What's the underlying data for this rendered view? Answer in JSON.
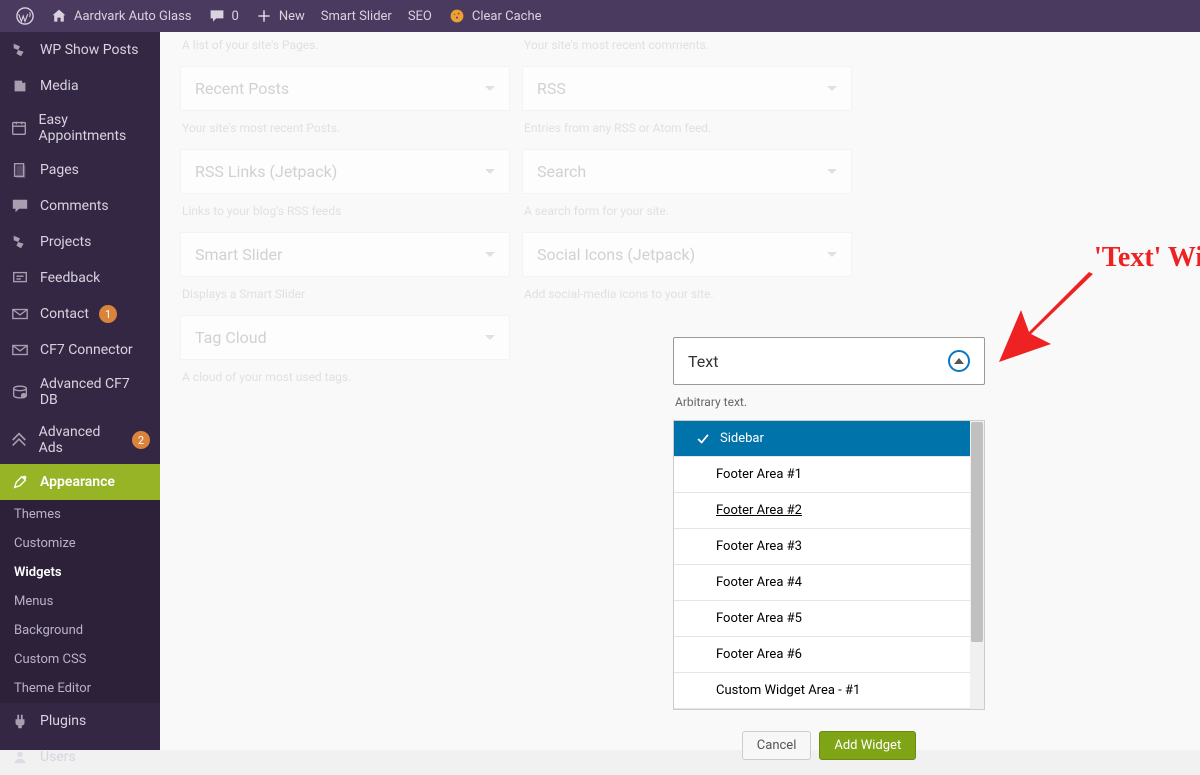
{
  "adminbar": {
    "site_name": "Aardvark Auto Glass",
    "comments": "0",
    "new": "New",
    "smart_slider": "Smart Slider",
    "seo": "SEO",
    "clear_cache": "Clear Cache"
  },
  "sidebar": {
    "items": [
      {
        "label": "WP Show Posts"
      },
      {
        "label": "Media"
      },
      {
        "label": "Easy Appointments"
      },
      {
        "label": "Pages"
      },
      {
        "label": "Comments"
      },
      {
        "label": "Projects"
      },
      {
        "label": "Feedback"
      },
      {
        "label": "Contact",
        "badge": "1"
      },
      {
        "label": "CF7 Connector"
      },
      {
        "label": "Advanced CF7 DB"
      },
      {
        "label": "Advanced Ads",
        "badge": "2"
      },
      {
        "label": "Appearance",
        "active": true
      },
      {
        "label": "Plugins"
      },
      {
        "label": "Users"
      }
    ],
    "submenu": [
      {
        "label": "Themes"
      },
      {
        "label": "Customize"
      },
      {
        "label": "Widgets",
        "current": true
      },
      {
        "label": "Menus"
      },
      {
        "label": "Background"
      },
      {
        "label": "Custom CSS"
      },
      {
        "label": "Theme Editor"
      }
    ]
  },
  "widgets_left": [
    {
      "title": "",
      "desc": "A list of your site's Pages."
    },
    {
      "title": "Recent Posts",
      "desc": "Your site's most recent Posts."
    },
    {
      "title": "RSS Links (Jetpack)",
      "desc": "Links to your blog's RSS feeds"
    },
    {
      "title": "Smart Slider",
      "desc": "Displays a Smart Slider"
    },
    {
      "title": "Tag Cloud",
      "desc": "A cloud of your most used tags."
    }
  ],
  "widgets_right": [
    {
      "title": "",
      "desc": "Your site's most recent comments."
    },
    {
      "title": "RSS",
      "desc": "Entries from any RSS or Atom feed."
    },
    {
      "title": "Search",
      "desc": "A search form for your site."
    },
    {
      "title": "Social Icons (Jetpack)",
      "desc": "Add social-media icons to your site."
    },
    {
      "title": "Text",
      "desc": "Arbitrary text.",
      "highlighted": true
    }
  ],
  "areas": [
    {
      "label": "Sidebar",
      "selected": true
    },
    {
      "label": "Footer Area #1"
    },
    {
      "label": "Footer Area #2",
      "underline": true
    },
    {
      "label": "Footer Area #3"
    },
    {
      "label": "Footer Area #4"
    },
    {
      "label": "Footer Area #5"
    },
    {
      "label": "Footer Area #6"
    },
    {
      "label": "Custom Widget Area - #1"
    }
  ],
  "buttons": {
    "cancel": "Cancel",
    "add": "Add Widget"
  },
  "annotation": {
    "label": "'Text' Widget"
  }
}
